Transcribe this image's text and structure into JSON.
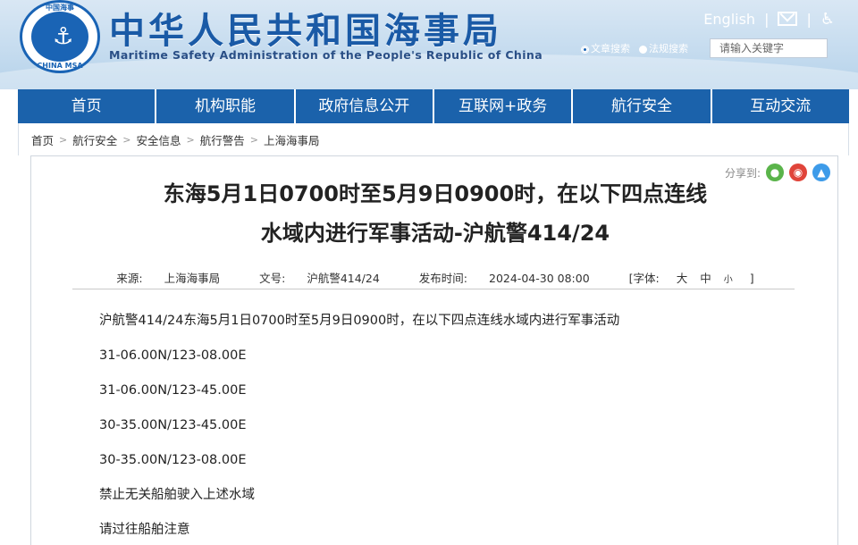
{
  "header": {
    "title": "中华人民共和国海事局",
    "subtitle": "Maritime Safety Administration of the People's Republic of China",
    "logo": {
      "top_text": "中国海事",
      "bottom_text": "CHINA MSA",
      "icon": "anchor-icon"
    },
    "english_link": "English",
    "separator": "|",
    "mail_icon": "mail-icon",
    "accessibility_icon": "accessibility-icon",
    "search_scopes": [
      "文章搜索",
      "法规搜索"
    ],
    "search_selected": "文章搜索",
    "search_placeholder": "请输入关键字"
  },
  "nav": {
    "items": [
      {
        "label": "首页"
      },
      {
        "label": "机构职能"
      },
      {
        "label": "政府信息公开"
      },
      {
        "label": "互联网+政务"
      },
      {
        "label": "航行安全"
      },
      {
        "label": "互动交流"
      }
    ]
  },
  "breadcrumb": {
    "items": [
      "首页",
      "航行安全",
      "安全信息",
      "航行警告",
      "上海海事局"
    ],
    "separator": ">"
  },
  "share": {
    "label": "分享到:",
    "icons": [
      "wechat-icon",
      "weibo-icon",
      "qq-icon"
    ]
  },
  "article": {
    "title_line1": "东海5月1日0700时至5月9日0900时，在以下四点连线",
    "title_line2": "水域内进行军事活动-沪航警414/24",
    "meta": {
      "source_label": "来源:",
      "source": "上海海事局",
      "doc_no_label": "文号:",
      "doc_no": "沪航警414/24",
      "published_label": "发布时间:",
      "published": "2024-04-30 08:00",
      "font_label": "[字体:",
      "font_large": "大",
      "font_medium": "中",
      "font_small": "小",
      "font_close": "]"
    },
    "paragraphs": [
      "沪航警414/24东海5月1日0700时至5月9日0900时，在以下四点连线水域内进行军事活动",
      "31-06.00N/123-08.00E",
      "31-06.00N/123-45.00E",
      "30-35.00N/123-45.00E",
      "30-35.00N/123-08.00E",
      "禁止无关船舶驶入上述水域",
      "请过往船舶注意"
    ]
  },
  "colors": {
    "nav_bg": "#1b62ab",
    "title_blue": "#1a5aa6",
    "header_bg": "#c6dcef"
  }
}
